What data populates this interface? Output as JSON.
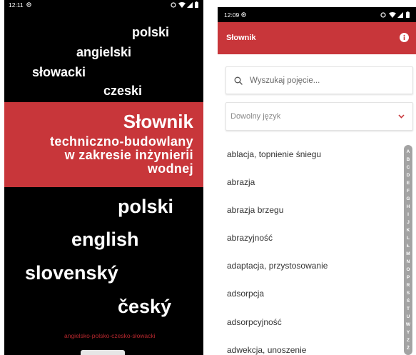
{
  "left_screen": {
    "status_bar": {
      "time": "12:11",
      "icons": [
        "notification-icon",
        "data-saver-icon",
        "wifi-icon",
        "signal-icon",
        "battery-icon"
      ]
    },
    "languages_top": [
      "polski",
      "angielski",
      "słowacki",
      "czeski"
    ],
    "banner": {
      "title": "Słownik",
      "subtitle_lines": [
        "techniczno-budowlany",
        "w zakresie inżynierii",
        "wodnej"
      ]
    },
    "languages_bottom": [
      "polski",
      "english",
      "slovenský",
      "český"
    ],
    "footer_text": "angielsko-polsko-czesko-słowacki"
  },
  "right_screen": {
    "status_bar": {
      "time": "12:09",
      "icons": [
        "notification-icon",
        "data-saver-icon",
        "wifi-icon",
        "signal-icon",
        "battery-icon"
      ]
    },
    "app_bar": {
      "title": "Słownik",
      "icon": "info-icon"
    },
    "search": {
      "placeholder": "Wyszukaj pojęcie...",
      "icon": "search-icon"
    },
    "language_select": {
      "selected": "Dowolny język",
      "icon": "chevron-down-icon"
    },
    "terms": [
      "ablacja, topnienie śniegu",
      "abrazja",
      "abrazja brzegu",
      "abrazyjność",
      "adaptacja, przystosowanie",
      "adsorpcja",
      "adsorpcyjność",
      "adwekcja, unoszenie"
    ],
    "alphabet_index": [
      "A",
      "B",
      "C",
      "D",
      "E",
      "F",
      "G",
      "H",
      "I",
      "J",
      "K",
      "L",
      "Ł",
      "M",
      "N",
      "O",
      "P",
      "R",
      "S",
      "Ś",
      "T",
      "U",
      "W",
      "Y",
      "Z",
      "Ż"
    ]
  },
  "colors": {
    "accent": "#c8363a",
    "screen_dark": "#000000",
    "term_text": "#333333",
    "index_bar": "#a3a3a3"
  }
}
